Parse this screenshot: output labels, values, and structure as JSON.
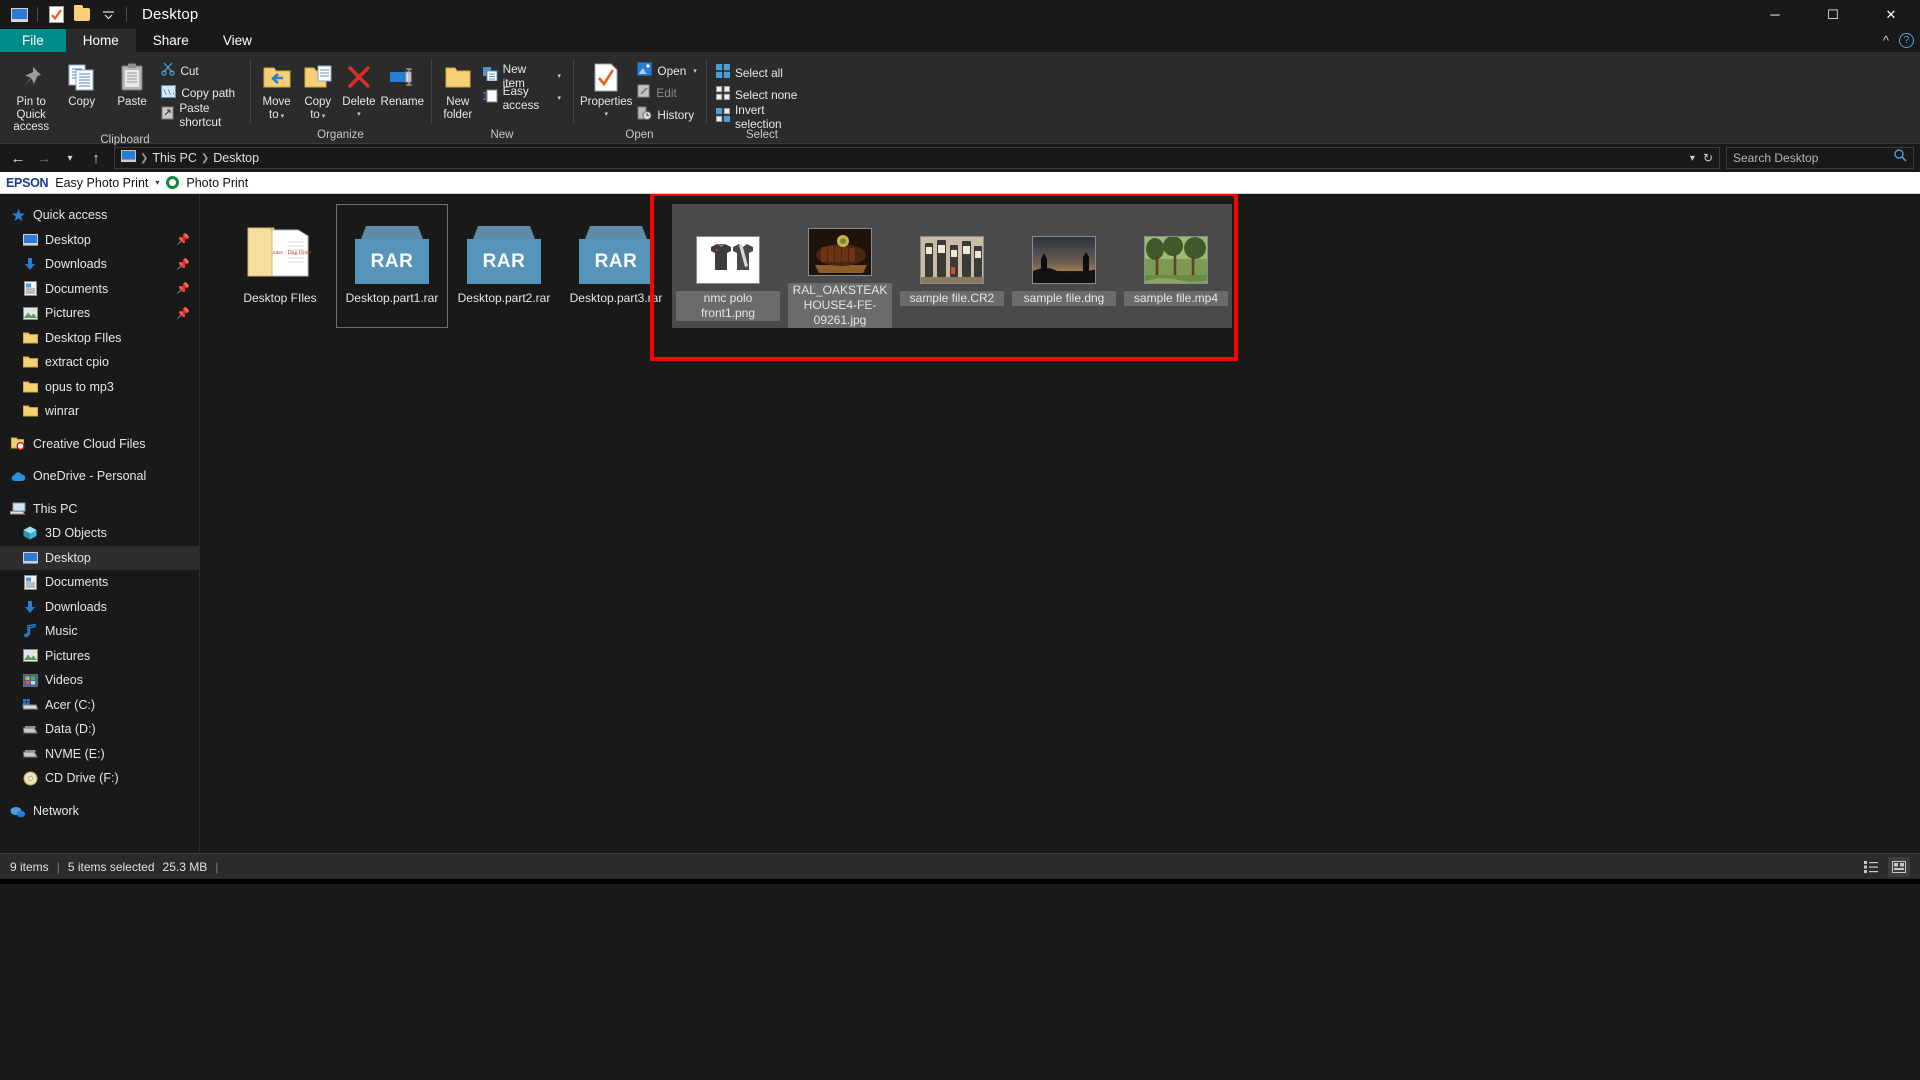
{
  "window": {
    "title": "Desktop",
    "quick_access_icons": [
      "explorer-icon",
      "properties-icon",
      "new-folder-icon",
      "customize-chevron-icon"
    ],
    "controls": {
      "minimize": "─",
      "maximize": "☐",
      "close": "✕"
    }
  },
  "ribbon": {
    "tabs": [
      {
        "label": "File",
        "active": false,
        "file": true
      },
      {
        "label": "Home",
        "active": true,
        "file": false
      },
      {
        "label": "Share",
        "active": false,
        "file": false
      },
      {
        "label": "View",
        "active": false,
        "file": false
      }
    ],
    "collapse_icon": "chevron-up-icon",
    "help_icon": "?",
    "groups": [
      {
        "title": "Clipboard",
        "big": [
          {
            "label": "Pin to Quick access",
            "icon": "pin-icon"
          },
          {
            "label": "Copy",
            "icon": "copy-icon"
          },
          {
            "label": "Paste",
            "icon": "paste-icon"
          }
        ],
        "small": [
          {
            "label": "Cut",
            "icon": "scissors-icon",
            "dim": false
          },
          {
            "label": "Copy path",
            "icon": "copy-path-icon",
            "dim": false
          },
          {
            "label": "Paste shortcut",
            "icon": "paste-shortcut-icon",
            "dim": false
          }
        ]
      },
      {
        "title": "Organize",
        "big": [
          {
            "label": "Move to",
            "icon": "move-to-icon",
            "caret": true
          },
          {
            "label": "Copy to",
            "icon": "copy-to-icon",
            "caret": true
          },
          {
            "label": "Delete",
            "icon": "delete-icon",
            "caret": true
          },
          {
            "label": "Rename",
            "icon": "rename-icon"
          }
        ],
        "small": []
      },
      {
        "title": "New",
        "big": [
          {
            "label": "New folder",
            "icon": "new-folder-icon"
          }
        ],
        "small": [
          {
            "label": "New item",
            "icon": "new-item-icon",
            "caret": true
          },
          {
            "label": "Easy access",
            "icon": "easy-access-icon",
            "caret": true
          }
        ]
      },
      {
        "title": "Open",
        "big": [
          {
            "label": "Properties",
            "icon": "properties-icon",
            "caret": true
          }
        ],
        "small": [
          {
            "label": "Open",
            "icon": "open-icon",
            "caret": true,
            "dim": false
          },
          {
            "label": "Edit",
            "icon": "edit-icon",
            "dim": true
          },
          {
            "label": "History",
            "icon": "history-icon",
            "dim": false
          }
        ]
      },
      {
        "title": "Select",
        "big": [],
        "small": [
          {
            "label": "Select all",
            "icon": "select-all-icon"
          },
          {
            "label": "Select none",
            "icon": "select-none-icon"
          },
          {
            "label": "Invert selection",
            "icon": "invert-selection-icon"
          }
        ]
      }
    ]
  },
  "address": {
    "back_icon": "back-arrow-icon",
    "forward_icon": "forward-arrow-icon",
    "recent_icon": "chevron-down-icon",
    "up_icon": "up-arrow-icon",
    "breadcrumbs": [
      "This PC",
      "Desktop"
    ],
    "dropdown_icon": "chevron-down-icon",
    "refresh_icon": "refresh-icon",
    "search_placeholder": "Search Desktop",
    "search_value": "",
    "search_icon": "search-icon"
  },
  "epson": {
    "logo": "EPSON",
    "menu": "Easy Photo Print",
    "caret": "▾",
    "button": "Photo Print"
  },
  "sidebar": {
    "items": [
      {
        "label": "Quick access",
        "icon": "star-icon",
        "level": 0,
        "pin": false,
        "selected": false
      },
      {
        "label": "Desktop",
        "icon": "desktop-icon",
        "level": 1,
        "pin": true,
        "selected": false
      },
      {
        "label": "Downloads",
        "icon": "downloads-icon",
        "level": 1,
        "pin": true,
        "selected": false
      },
      {
        "label": "Documents",
        "icon": "documents-icon",
        "level": 1,
        "pin": true,
        "selected": false
      },
      {
        "label": "Pictures",
        "icon": "pictures-icon",
        "level": 1,
        "pin": true,
        "selected": false
      },
      {
        "label": "Desktop FIles",
        "icon": "folder-icon",
        "level": 1,
        "pin": false,
        "selected": false
      },
      {
        "label": "extract cpio",
        "icon": "folder-icon",
        "level": 1,
        "pin": false,
        "selected": false
      },
      {
        "label": "opus to mp3",
        "icon": "folder-icon",
        "level": 1,
        "pin": false,
        "selected": false
      },
      {
        "label": "winrar",
        "icon": "folder-icon",
        "level": 1,
        "pin": false,
        "selected": false
      },
      {
        "label": "Creative Cloud Files",
        "icon": "creative-cloud-icon",
        "level": 0,
        "pin": false,
        "selected": false,
        "gap_before": true
      },
      {
        "label": "OneDrive - Personal",
        "icon": "onedrive-icon",
        "level": 0,
        "pin": false,
        "selected": false,
        "gap_before": true
      },
      {
        "label": "This PC",
        "icon": "this-pc-icon",
        "level": 0,
        "pin": false,
        "selected": false,
        "gap_before": true
      },
      {
        "label": "3D Objects",
        "icon": "3d-objects-icon",
        "level": 1,
        "pin": false,
        "selected": false
      },
      {
        "label": "Desktop",
        "icon": "desktop-icon",
        "level": 1,
        "pin": false,
        "selected": true
      },
      {
        "label": "Documents",
        "icon": "documents-icon",
        "level": 1,
        "pin": false,
        "selected": false
      },
      {
        "label": "Downloads",
        "icon": "downloads-icon",
        "level": 1,
        "pin": false,
        "selected": false
      },
      {
        "label": "Music",
        "icon": "music-icon",
        "level": 1,
        "pin": false,
        "selected": false
      },
      {
        "label": "Pictures",
        "icon": "pictures-icon",
        "level": 1,
        "pin": false,
        "selected": false
      },
      {
        "label": "Videos",
        "icon": "videos-icon",
        "level": 1,
        "pin": false,
        "selected": false
      },
      {
        "label": "Acer (C:)",
        "icon": "windows-drive-icon",
        "level": 1,
        "pin": false,
        "selected": false
      },
      {
        "label": "Data (D:)",
        "icon": "drive-icon",
        "level": 1,
        "pin": false,
        "selected": false
      },
      {
        "label": "NVME (E:)",
        "icon": "drive-icon",
        "level": 1,
        "pin": false,
        "selected": false
      },
      {
        "label": "CD Drive (F:)",
        "icon": "cd-drive-icon",
        "level": 1,
        "pin": false,
        "selected": false
      },
      {
        "label": "Network",
        "icon": "network-icon",
        "level": 0,
        "pin": false,
        "selected": false,
        "gap_before": true
      }
    ]
  },
  "files": [
    {
      "name": "Desktop FIles",
      "type": "folder",
      "selected": false,
      "focused": false
    },
    {
      "name": "Desktop.part1.rar",
      "type": "rar",
      "selected": false,
      "focused": true
    },
    {
      "name": "Desktop.part2.rar",
      "type": "rar",
      "selected": false,
      "focused": false
    },
    {
      "name": "Desktop.part3.rar",
      "type": "rar",
      "selected": false,
      "focused": false
    },
    {
      "name": "nmc polo front1.png",
      "type": "image-polo",
      "selected": true,
      "focused": false
    },
    {
      "name": "RAL_OAKSTEAKHOUSE4-FE-09261.jpg",
      "type": "image-steak",
      "selected": true,
      "focused": false
    },
    {
      "name": "sample file.CR2",
      "type": "image-shelf",
      "selected": true,
      "focused": false
    },
    {
      "name": "sample file.dng",
      "type": "image-sunset",
      "selected": true,
      "focused": false
    },
    {
      "name": "sample file.mp4",
      "type": "image-forest",
      "selected": true,
      "focused": false
    }
  ],
  "annotation": {
    "color": "#ff0000",
    "shape": "rectangle"
  },
  "status": {
    "item_count": "9 items",
    "separator": "|",
    "selection": "5 items selected",
    "size": "25.3 MB",
    "trailing_separator": "|",
    "view_details_icon": "details-view-icon",
    "view_large_icon": "large-icons-view-icon"
  }
}
